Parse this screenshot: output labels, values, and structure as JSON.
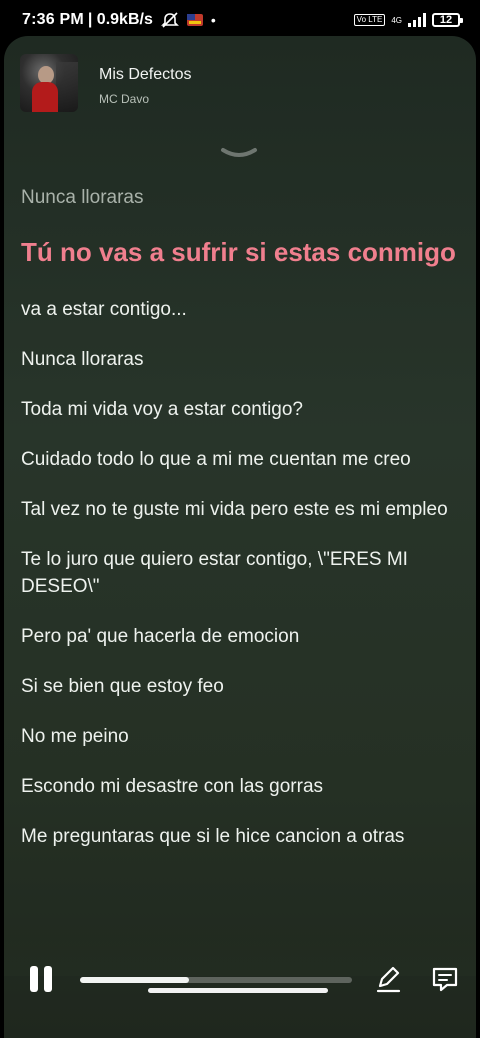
{
  "status_bar": {
    "time": "7:36 PM",
    "network_speed": "| 0.9kB/s",
    "signal_label": "4G",
    "volte_label": "Vo LTE",
    "battery_level": "12"
  },
  "player": {
    "title": "Mis Defectos",
    "artist": "MC Davo",
    "progress_fraction": 0.4
  },
  "lyrics": {
    "lines": [
      {
        "text": "Nunca lloraras",
        "state": "past"
      },
      {
        "text": "Tú no vas a sufrir si estas conmigo",
        "state": "active"
      },
      {
        "text": "va a estar contigo...",
        "state": "upcoming"
      },
      {
        "text": "Nunca lloraras",
        "state": "upcoming"
      },
      {
        "text": "Toda mi vida voy a estar contigo?",
        "state": "upcoming"
      },
      {
        "text": "Cuidado todo lo que a mi me cuentan me creo",
        "state": "upcoming"
      },
      {
        "text": "Tal vez no te guste mi vida pero este es mi empleo",
        "state": "upcoming"
      },
      {
        "text": "Te lo juro que quiero estar contigo, \\\"ERES MI DESEO\\\"",
        "state": "upcoming"
      },
      {
        "text": "Pero pa' que hacerla de emocion",
        "state": "upcoming"
      },
      {
        "text": "Si se bien que estoy feo",
        "state": "upcoming"
      },
      {
        "text": "No me peino",
        "state": "upcoming"
      },
      {
        "text": "Escondo mi desastre con las gorras",
        "state": "upcoming"
      },
      {
        "text": "Me preguntaras que si le hice cancion a otras",
        "state": "upcoming"
      }
    ]
  },
  "icons": {
    "pause": "pause-icon",
    "edit": "pencil-icon",
    "comment": "comment-icon",
    "collapse": "chevron-down-icon"
  },
  "colors": {
    "active_lyric": "#f07f8e",
    "background": "#28352a"
  }
}
